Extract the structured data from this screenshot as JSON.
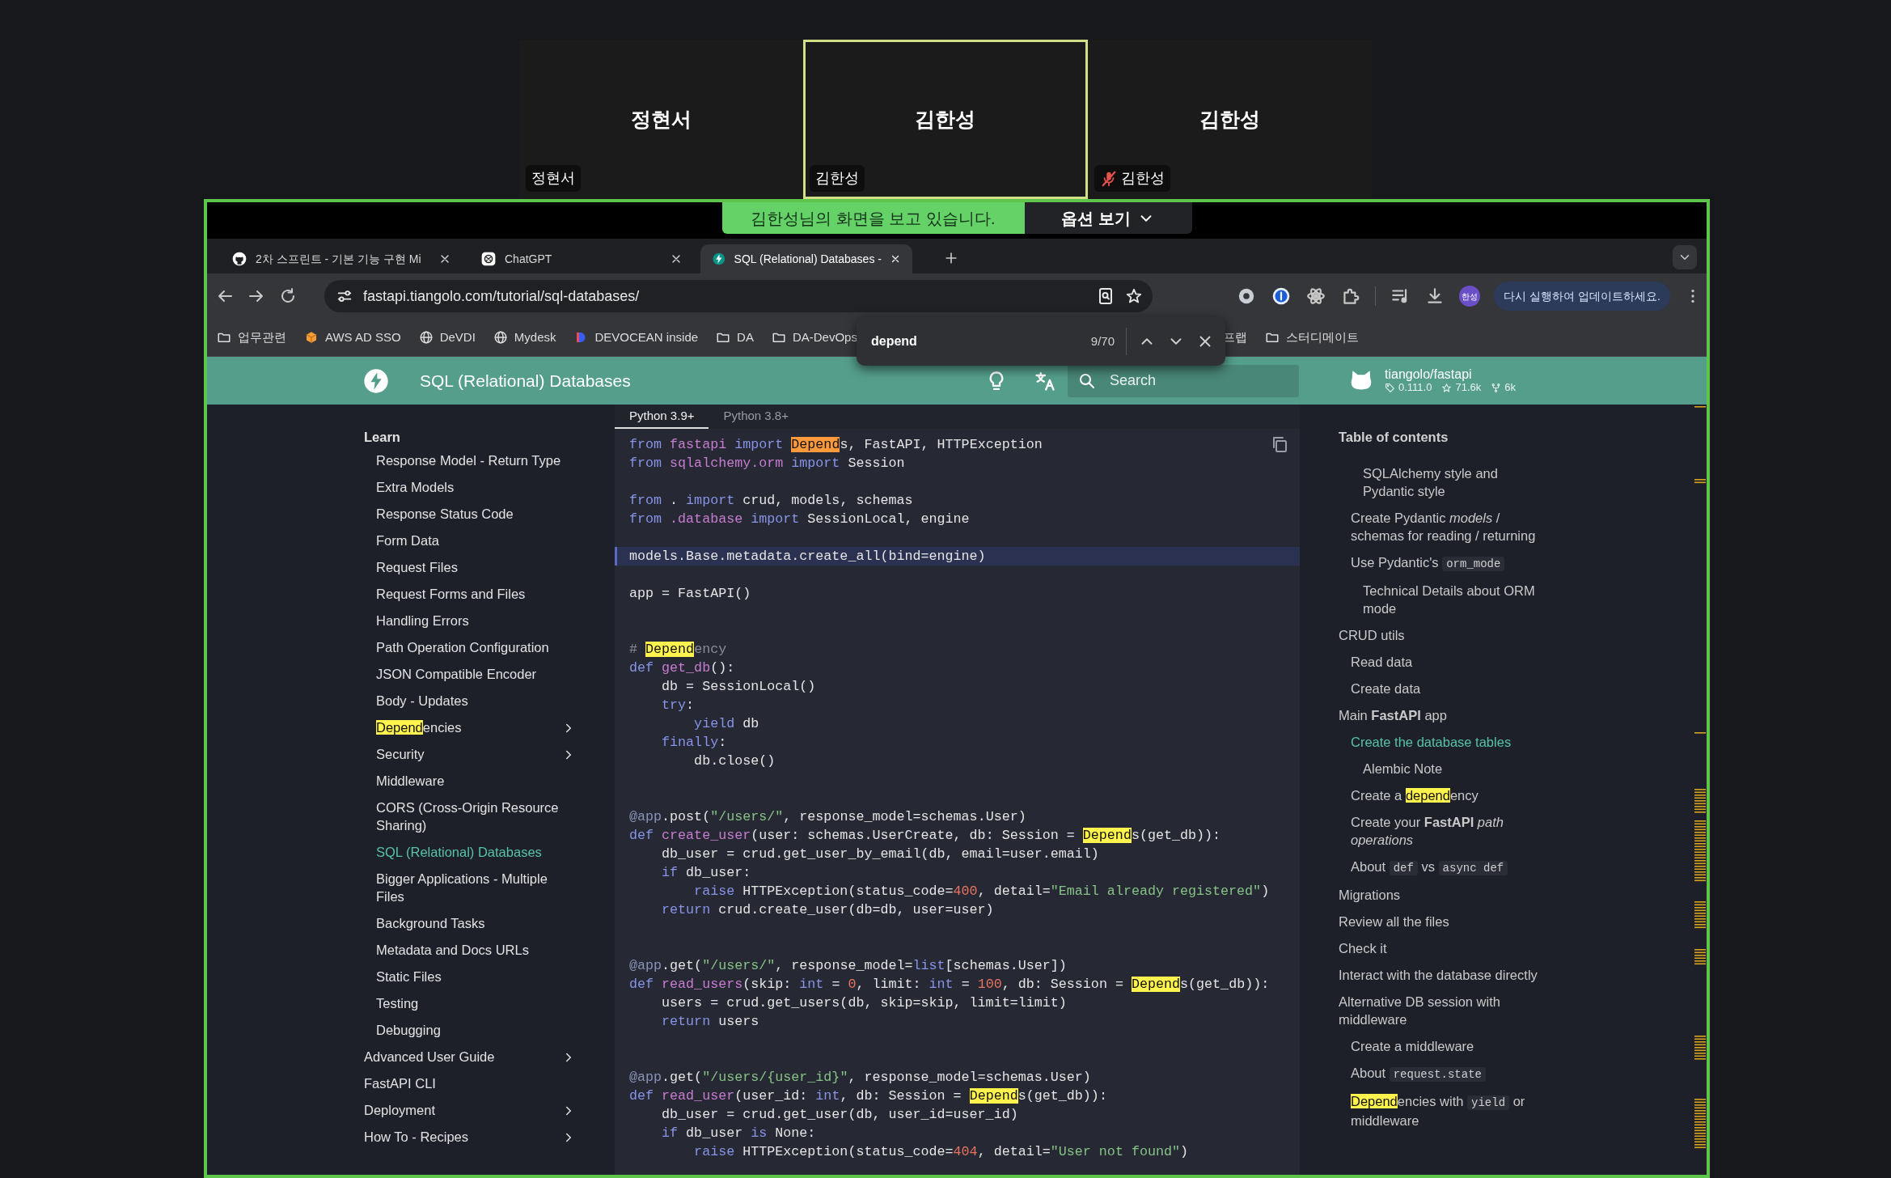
{
  "meeting": {
    "participants": [
      {
        "name": "정현서",
        "tag": "정현서",
        "speaking": false,
        "muted": false
      },
      {
        "name": "김한성",
        "tag": "김한성",
        "speaking": true,
        "muted": false
      },
      {
        "name": "김한성",
        "tag": "김한성",
        "speaking": false,
        "muted": true
      }
    ],
    "share_banner": "김한성님의 화면을 보고 있습니다.",
    "options_button": "옵션 보기"
  },
  "browser": {
    "tabs": [
      {
        "title": "2차 스프린트 - 기본 기능 구현 Mi",
        "kind": "github",
        "selected": false
      },
      {
        "title": "ChatGPT",
        "kind": "chatgpt",
        "selected": false
      },
      {
        "title": "SQL (Relational) Databases -",
        "kind": "fastapi",
        "selected": true
      }
    ],
    "url": "fastapi.tiangolo.com/tutorial/sql-databases/",
    "profile": "한성",
    "update_notice": "다시 실행하여 업데이트하세요.",
    "bookmarks": [
      {
        "label": "업무관련",
        "kind": "folder"
      },
      {
        "label": "AWS AD SSO",
        "kind": "box"
      },
      {
        "label": "DeVDI",
        "kind": "globe"
      },
      {
        "label": "Mydesk",
        "kind": "globe"
      },
      {
        "label": "DEVOCEAN inside",
        "kind": "logo"
      },
      {
        "label": "DA",
        "kind": "folder"
      },
      {
        "label": "DA-DevOps",
        "kind": "folder"
      },
      {
        "label": "프랩"
      },
      {
        "label": "스터디메이트",
        "kind": "folder"
      }
    ],
    "find": {
      "query": "depend",
      "count": "9/70"
    }
  },
  "site": {
    "title": "SQL (Relational) Databases",
    "search_placeholder": "Search",
    "repo": {
      "name": "tiangolo/fastapi",
      "version": "0.111.0",
      "stars": "71.6k",
      "forks": "6k"
    }
  },
  "nav": {
    "items": [
      {
        "label": "Learn",
        "selected": false,
        "has_submenu": false,
        "children": [
          {
            "label": "Response Model - Return Type",
            "selected": false,
            "has_submenu": false
          },
          {
            "label": "Extra Models",
            "selected": false,
            "has_submenu": false
          },
          {
            "label": "Response Status Code",
            "selected": false,
            "has_submenu": false
          },
          {
            "label": "Form Data",
            "selected": false,
            "has_submenu": false
          },
          {
            "label": "Request Files",
            "selected": false,
            "has_submenu": false
          },
          {
            "label": "Request Forms and Files",
            "selected": false,
            "has_submenu": false
          },
          {
            "label": "Handling Errors",
            "selected": false,
            "has_submenu": false
          },
          {
            "label": "Path Operation Configuration",
            "selected": false,
            "has_submenu": false
          },
          {
            "label": "JSON Compatible Encoder",
            "selected": false,
            "has_submenu": false
          },
          {
            "label": "Body - Updates",
            "selected": false,
            "has_submenu": false
          },
          {
            "parts": [
              {
                "kind": "match",
                "text": "Depend"
              },
              {
                "kind": "text",
                "text": "encies"
              }
            ],
            "selected": false,
            "has_submenu": true
          },
          {
            "label": "Security",
            "selected": false,
            "has_submenu": true
          },
          {
            "label": "Middleware",
            "selected": false,
            "has_submenu": false
          },
          {
            "label": "CORS (Cross-Origin Resource Sharing)",
            "selected": false,
            "has_submenu": false
          },
          {
            "label": "SQL (Relational) Databases",
            "selected": true,
            "has_submenu": false
          },
          {
            "label": "Bigger Applications - Multiple Files",
            "selected": false,
            "has_submenu": false
          },
          {
            "label": "Background Tasks",
            "selected": false,
            "has_submenu": false
          },
          {
            "label": "Metadata and Docs URLs",
            "selected": false,
            "has_submenu": false
          },
          {
            "label": "Static Files",
            "selected": false,
            "has_submenu": false
          },
          {
            "label": "Testing",
            "selected": false,
            "has_submenu": false
          },
          {
            "label": "Debugging",
            "selected": false,
            "has_submenu": false
          }
        ]
      },
      {
        "label": "Advanced User Guide",
        "selected": false,
        "has_submenu": true
      },
      {
        "label": "FastAPI CLI",
        "selected": false,
        "has_submenu": false
      },
      {
        "label": "Deployment",
        "selected": false,
        "has_submenu": true
      },
      {
        "label": "How To - Recipes",
        "selected": false,
        "has_submenu": true
      }
    ]
  },
  "code": {
    "tabs": [
      {
        "label": "Python 3.9+",
        "selected": true
      },
      {
        "label": "Python 3.8+",
        "selected": false
      }
    ],
    "lines": [
      {
        "kind": "code",
        "highlighted": false,
        "tokens": [
          {
            "kind": "keyword",
            "text": "from "
          },
          {
            "kind": "name",
            "text": "fastapi "
          },
          {
            "kind": "keyword",
            "text": "import "
          },
          {
            "kind": "current_match",
            "text": "Depend"
          },
          {
            "kind": "text",
            "text": "s, FastAPI, HTTPException"
          }
        ]
      },
      {
        "kind": "code",
        "highlighted": false,
        "tokens": [
          {
            "kind": "keyword",
            "text": "from "
          },
          {
            "kind": "name",
            "text": "sqlalchemy.orm "
          },
          {
            "kind": "keyword",
            "text": "import "
          },
          {
            "kind": "text",
            "text": "Session"
          }
        ]
      },
      {
        "kind": "blank"
      },
      {
        "kind": "code",
        "highlighted": false,
        "tokens": [
          {
            "kind": "keyword",
            "text": "from "
          },
          {
            "kind": "text",
            "text": ". "
          },
          {
            "kind": "keyword",
            "text": "import "
          },
          {
            "kind": "text",
            "text": "crud, models, schemas"
          }
        ]
      },
      {
        "kind": "code",
        "highlighted": false,
        "tokens": [
          {
            "kind": "keyword",
            "text": "from "
          },
          {
            "kind": "name",
            "text": ".database "
          },
          {
            "kind": "keyword",
            "text": "import "
          },
          {
            "kind": "text",
            "text": "SessionLocal, engine"
          }
        ]
      },
      {
        "kind": "blank"
      },
      {
        "kind": "code",
        "highlighted": true,
        "tokens": [
          {
            "kind": "text",
            "text": "models.Base.metadata.create_all(bind=engine)"
          }
        ]
      },
      {
        "kind": "blank"
      },
      {
        "kind": "code",
        "highlighted": false,
        "tokens": [
          {
            "kind": "text",
            "text": "app = FastAPI()"
          }
        ]
      },
      {
        "kind": "blank"
      },
      {
        "kind": "blank"
      },
      {
        "kind": "code",
        "highlighted": false,
        "tokens": [
          {
            "kind": "comment",
            "text": "# "
          },
          {
            "kind": "match",
            "text": "Depend"
          },
          {
            "kind": "comment",
            "text": "ency"
          }
        ]
      },
      {
        "kind": "code",
        "highlighted": false,
        "tokens": [
          {
            "kind": "keyword",
            "text": "def "
          },
          {
            "kind": "name",
            "text": "get_db"
          },
          {
            "kind": "text",
            "text": "():"
          }
        ]
      },
      {
        "kind": "code",
        "highlighted": false,
        "tokens": [
          {
            "kind": "text",
            "text": "    db = SessionLocal()"
          }
        ]
      },
      {
        "kind": "code",
        "highlighted": false,
        "tokens": [
          {
            "kind": "keyword",
            "text": "    try"
          },
          {
            "kind": "text",
            "text": ":"
          }
        ]
      },
      {
        "kind": "code",
        "highlighted": false,
        "tokens": [
          {
            "kind": "keyword",
            "text": "        yield "
          },
          {
            "kind": "text",
            "text": "db"
          }
        ]
      },
      {
        "kind": "code",
        "highlighted": false,
        "tokens": [
          {
            "kind": "keyword",
            "text": "    finally"
          },
          {
            "kind": "text",
            "text": ":"
          }
        ]
      },
      {
        "kind": "code",
        "highlighted": false,
        "tokens": [
          {
            "kind": "text",
            "text": "        db.close()"
          }
        ]
      },
      {
        "kind": "blank"
      },
      {
        "kind": "blank"
      },
      {
        "kind": "code",
        "highlighted": false,
        "tokens": [
          {
            "kind": "decorator",
            "text": "@app"
          },
          {
            "kind": "text",
            "text": ".post("
          },
          {
            "kind": "string",
            "text": "\"/users/\""
          },
          {
            "kind": "text",
            "text": ", response_model=schemas.User)"
          }
        ]
      },
      {
        "kind": "code",
        "highlighted": false,
        "tokens": [
          {
            "kind": "keyword",
            "text": "def "
          },
          {
            "kind": "name",
            "text": "create_user"
          },
          {
            "kind": "text",
            "text": "(user: schemas.UserCreate, db: Session = "
          },
          {
            "kind": "match",
            "text": "Depend"
          },
          {
            "kind": "text",
            "text": "s(get_db)):"
          }
        ]
      },
      {
        "kind": "code",
        "highlighted": false,
        "tokens": [
          {
            "kind": "text",
            "text": "    db_user = crud.get_user_by_email(db, email=user.email)"
          }
        ]
      },
      {
        "kind": "code",
        "highlighted": false,
        "tokens": [
          {
            "kind": "keyword",
            "text": "    if "
          },
          {
            "kind": "text",
            "text": "db_user:"
          }
        ]
      },
      {
        "kind": "code",
        "highlighted": false,
        "tokens": [
          {
            "kind": "keyword",
            "text": "        raise "
          },
          {
            "kind": "text",
            "text": "HTTPException(status_code="
          },
          {
            "kind": "number",
            "text": "400"
          },
          {
            "kind": "text",
            "text": ", detail="
          },
          {
            "kind": "string",
            "text": "\"Email already registered\""
          },
          {
            "kind": "text",
            "text": ")"
          }
        ]
      },
      {
        "kind": "code",
        "highlighted": false,
        "tokens": [
          {
            "kind": "keyword",
            "text": "    return "
          },
          {
            "kind": "text",
            "text": "crud.create_user(db=db, user=user)"
          }
        ]
      },
      {
        "kind": "blank"
      },
      {
        "kind": "blank"
      },
      {
        "kind": "code",
        "highlighted": false,
        "tokens": [
          {
            "kind": "decorator",
            "text": "@app"
          },
          {
            "kind": "text",
            "text": ".get("
          },
          {
            "kind": "string",
            "text": "\"/users/\""
          },
          {
            "kind": "text",
            "text": ", response_model="
          },
          {
            "kind": "keyword",
            "text": "list"
          },
          {
            "kind": "text",
            "text": "[schemas.User])"
          }
        ]
      },
      {
        "kind": "code",
        "highlighted": false,
        "tokens": [
          {
            "kind": "keyword",
            "text": "def "
          },
          {
            "kind": "name",
            "text": "read_users"
          },
          {
            "kind": "text",
            "text": "(skip: "
          },
          {
            "kind": "keyword",
            "text": "int"
          },
          {
            "kind": "text",
            "text": " = "
          },
          {
            "kind": "number",
            "text": "0"
          },
          {
            "kind": "text",
            "text": ", limit: "
          },
          {
            "kind": "keyword",
            "text": "int"
          },
          {
            "kind": "text",
            "text": " = "
          },
          {
            "kind": "number",
            "text": "100"
          },
          {
            "kind": "text",
            "text": ", db: Session = "
          },
          {
            "kind": "match",
            "text": "Depend"
          },
          {
            "kind": "text",
            "text": "s(get_db)):"
          }
        ]
      },
      {
        "kind": "code",
        "highlighted": false,
        "tokens": [
          {
            "kind": "text",
            "text": "    users = crud.get_users(db, skip=skip, limit=limit)"
          }
        ]
      },
      {
        "kind": "code",
        "highlighted": false,
        "tokens": [
          {
            "kind": "keyword",
            "text": "    return "
          },
          {
            "kind": "text",
            "text": "users"
          }
        ]
      },
      {
        "kind": "blank"
      },
      {
        "kind": "blank"
      },
      {
        "kind": "code",
        "highlighted": false,
        "tokens": [
          {
            "kind": "decorator",
            "text": "@app"
          },
          {
            "kind": "text",
            "text": ".get("
          },
          {
            "kind": "string",
            "text": "\"/users/{user_id}\""
          },
          {
            "kind": "text",
            "text": ", response_model=schemas.User)"
          }
        ]
      },
      {
        "kind": "code",
        "highlighted": false,
        "tokens": [
          {
            "kind": "keyword",
            "text": "def "
          },
          {
            "kind": "name",
            "text": "read_user"
          },
          {
            "kind": "text",
            "text": "(user_id: "
          },
          {
            "kind": "keyword",
            "text": "int"
          },
          {
            "kind": "text",
            "text": ", db: Session = "
          },
          {
            "kind": "match",
            "text": "Depend"
          },
          {
            "kind": "text",
            "text": "s(get_db)):"
          }
        ]
      },
      {
        "kind": "code",
        "highlighted": false,
        "tokens": [
          {
            "kind": "text",
            "text": "    db_user = crud.get_user(db, user_id=user_id)"
          }
        ]
      },
      {
        "kind": "code",
        "highlighted": false,
        "tokens": [
          {
            "kind": "keyword",
            "text": "    if "
          },
          {
            "kind": "text",
            "text": "db_user "
          },
          {
            "kind": "keyword",
            "text": "is "
          },
          {
            "kind": "text",
            "text": "None:"
          }
        ]
      },
      {
        "kind": "code",
        "highlighted": false,
        "tokens": [
          {
            "kind": "keyword",
            "text": "        raise "
          },
          {
            "kind": "text",
            "text": "HTTPException(status_code="
          },
          {
            "kind": "number",
            "text": "404"
          },
          {
            "kind": "text",
            "text": ", detail="
          },
          {
            "kind": "string",
            "text": "\"User not found\""
          },
          {
            "kind": "text",
            "text": ")"
          }
        ]
      }
    ]
  },
  "toc": {
    "title": "Table of contents",
    "items": [
      {
        "children": [
          {
            "children": [
              {
                "label": "SQLAlchemy style and Pydantic style",
                "selected": false
              }
            ]
          },
          {
            "parts": [
              {
                "kind": "text",
                "text": "Create Pydantic "
              },
              {
                "kind": "italic",
                "text": "models"
              },
              {
                "kind": "text",
                "text": " / schemas for reading / returning"
              }
            ],
            "selected": false
          },
          {
            "parts": [
              {
                "kind": "text",
                "text": "Use Pydantic's "
              },
              {
                "kind": "code",
                "text": "orm_mode"
              }
            ],
            "selected": false,
            "children": [
              {
                "label": "Technical Details about ORM mode",
                "selected": false
              }
            ]
          }
        ]
      },
      {
        "label": "CRUD utils",
        "selected": false,
        "children": [
          {
            "label": "Read data",
            "selected": false
          },
          {
            "label": "Create data",
            "selected": false
          }
        ]
      },
      {
        "parts": [
          {
            "kind": "text",
            "text": "Main "
          },
          {
            "kind": "bold",
            "text": "FastAPI"
          },
          {
            "kind": "text",
            "text": " app"
          }
        ],
        "selected": false,
        "children": [
          {
            "label": "Create the database tables",
            "selected": true,
            "children": [
              {
                "label": "Alembic Note",
                "selected": false
              }
            ]
          },
          {
            "parts": [
              {
                "kind": "text",
                "text": "Create a "
              },
              {
                "kind": "match",
                "text": "depend"
              },
              {
                "kind": "text",
                "text": "ency"
              }
            ],
            "selected": false
          },
          {
            "parts": [
              {
                "kind": "text",
                "text": "Create your "
              },
              {
                "kind": "bold",
                "text": "FastAPI"
              },
              {
                "kind": "italic",
                "text": " path operations"
              }
            ],
            "selected": false
          },
          {
            "parts": [
              {
                "kind": "text",
                "text": "About "
              },
              {
                "kind": "code",
                "text": "def"
              },
              {
                "kind": "text",
                "text": " vs "
              },
              {
                "kind": "code",
                "text": "async def"
              }
            ],
            "selected": false
          }
        ]
      },
      {
        "label": "Migrations",
        "selected": false
      },
      {
        "label": "Review all the files",
        "selected": false
      },
      {
        "label": "Check it",
        "selected": false
      },
      {
        "label": "Interact with the database directly",
        "selected": false
      },
      {
        "label": "Alternative DB session with middleware",
        "selected": false,
        "children": [
          {
            "label": "Create a middleware",
            "selected": false
          },
          {
            "parts": [
              {
                "kind": "text",
                "text": "About "
              },
              {
                "kind": "code",
                "text": "request.state"
              }
            ],
            "selected": false
          },
          {
            "parts": [
              {
                "kind": "match",
                "text": "Depend"
              },
              {
                "kind": "text",
                "text": "encies with "
              },
              {
                "kind": "code",
                "text": "yield"
              },
              {
                "kind": "text",
                "text": " or middleware"
              }
            ],
            "selected": false
          }
        ]
      }
    ]
  }
}
